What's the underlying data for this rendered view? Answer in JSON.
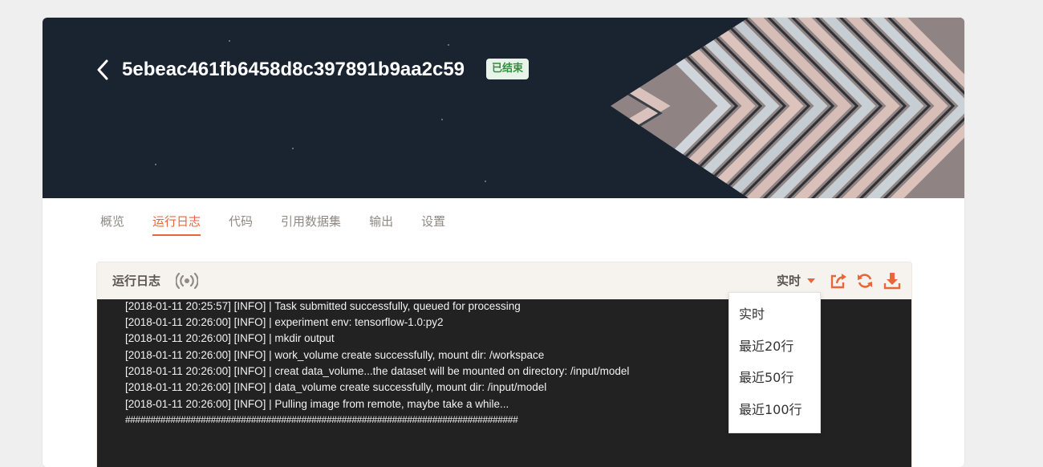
{
  "task": {
    "id": "5ebeac461fb6458d8c397891b9aa2c59",
    "status": "已结束"
  },
  "tabs": [
    "概览",
    "运行日志",
    "代码",
    "引用数据集",
    "输出",
    "设置"
  ],
  "log_panel": {
    "title": "运行日志",
    "mode": "实时",
    "mode_options": [
      "实时",
      "最近20行",
      "最近50行",
      "最近100行"
    ],
    "lines": [
      "[2018-01-11 20:25:57] [INFO] | Task submitted successfully, queued for processing",
      "[2018-01-11 20:26:00] [INFO] | experiment env: tensorflow-1.0:py2",
      "[2018-01-11 20:26:00] [INFO] | mkdir output",
      "[2018-01-11 20:26:00] [INFO] | work_volume create successfully, mount dir: /workspace",
      "[2018-01-11 20:26:00] [INFO] | creat data_volume...the dataset will be mounted on directory: /input/model",
      "[2018-01-11 20:26:00] [INFO] | data_volume create successfully, mount dir: /input/model",
      "[2018-01-11 20:26:00] [INFO] | Pulling image from remote, maybe take a while...",
      "##############################################################################"
    ]
  },
  "colors": {
    "accent": "#e8663a",
    "hero_bg": "#1a2431",
    "status_green": "#2f8f3c",
    "log_bg": "#222222"
  },
  "icons": [
    "back-arrow-icon",
    "live-signal-icon",
    "caret-down-icon",
    "share-icon",
    "refresh-icon",
    "download-icon"
  ]
}
